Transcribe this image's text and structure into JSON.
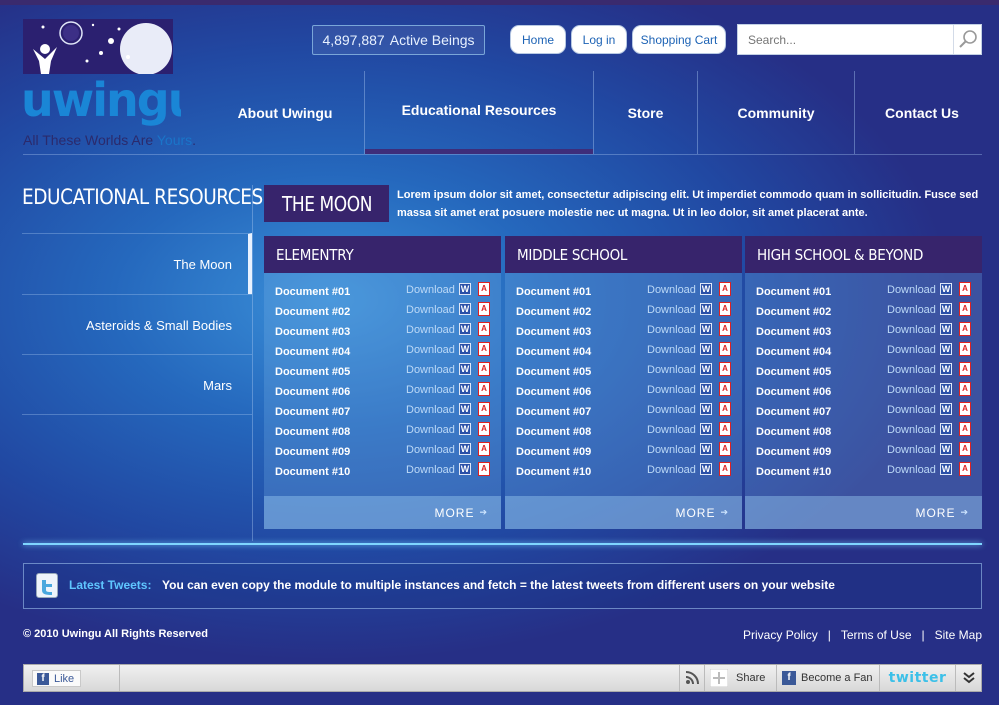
{
  "brand": {
    "logo_text": "uwingu",
    "tagline_prefix": "All These Worlds Are",
    "tagline_highlight": "Yours",
    "tagline_suffix": "."
  },
  "counter": {
    "value": "4,897,887",
    "label": "Active Beings"
  },
  "top_buttons": {
    "home": "Home",
    "login": "Log in",
    "cart": "Shopping Cart"
  },
  "search": {
    "placeholder": "Search..."
  },
  "nav": {
    "about": "About Uwingu",
    "education": "Educational Resources",
    "store": "Store",
    "community": "Community",
    "contact": "Contact Us"
  },
  "sidebar": {
    "title": "EDUCATIONAL RESOURCES",
    "items": [
      {
        "label": "The Moon"
      },
      {
        "label": "Asteroids & Small Bodies"
      },
      {
        "label": "Mars"
      }
    ]
  },
  "section": {
    "title": "THE MOON",
    "intro": "Lorem ipsum dolor sit amet, consectetur adipiscing elit. Ut imperdiet commodo quam in sollicitudin. Fusce sed massa sit amet erat posuere molestie nec ut magna. Ut in leo dolor, sit amet placerat ante."
  },
  "download_label": "Download",
  "word_icon_text": "W",
  "pdf_icon_text": "A",
  "more_label": "MORE",
  "columns": [
    {
      "title": "ELEMENTRY",
      "docs": [
        "Document #01",
        "Document #02",
        "Document #03",
        "Document #04",
        "Document #05",
        "Document #06",
        "Document #07",
        "Document #08",
        "Document #09",
        "Document #10"
      ]
    },
    {
      "title": "MIDDLE SCHOOL",
      "docs": [
        "Document #01",
        "Document #02",
        "Document #03",
        "Document #04",
        "Document #05",
        "Document #06",
        "Document #07",
        "Document #08",
        "Document #09",
        "Document #10"
      ]
    },
    {
      "title": "HIGH SCHOOL & BEYOND",
      "docs": [
        "Document #01",
        "Document #02",
        "Document #03",
        "Document #04",
        "Document #05",
        "Document #06",
        "Document #07",
        "Document #08",
        "Document #09",
        "Document #10"
      ]
    }
  ],
  "tweets": {
    "label": "Latest Tweets:",
    "text": "You can even copy the module to multiple instances and fetch = the latest tweets from different users on your website"
  },
  "footer": {
    "copyright": "© 2010 Uwingu All Rights Reserved",
    "privacy": "Privacy Policy",
    "terms": "Terms of Use",
    "sitemap": "Site Map",
    "separator": "|"
  },
  "social_bar": {
    "like": "Like",
    "share": "Share",
    "fan": "Become a Fan",
    "twitter": "twitter"
  },
  "colors": {
    "header_purple": "#37246c",
    "link_blue": "#1d63b5",
    "tweet_label": "#5fc6ff"
  }
}
